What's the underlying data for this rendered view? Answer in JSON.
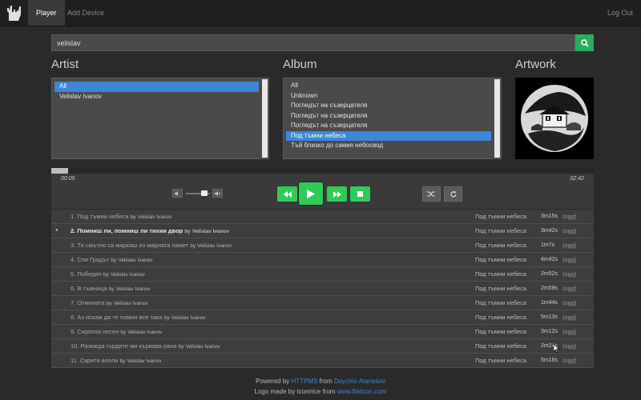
{
  "nav": {
    "tabs": [
      {
        "label": "Player"
      },
      {
        "label": "Add Device"
      }
    ],
    "logout_label": "Log Out"
  },
  "search": {
    "value": "velislav"
  },
  "sections": {
    "artist": "Artist",
    "album": "Album",
    "artwork": "Artwork"
  },
  "artists": [
    {
      "label": "All",
      "selected": true
    },
    {
      "label": "Velislav Ivanov",
      "selected": false
    }
  ],
  "albums": [
    {
      "label": "All",
      "selected": false
    },
    {
      "label": "Unknown",
      "selected": false
    },
    {
      "label": "Погледът на съзерцателя",
      "selected": false
    },
    {
      "label": "Погледът на съзерцателя",
      "selected": false
    },
    {
      "label": "Погледът на съзерцателя",
      "selected": false
    },
    {
      "label": "Под тъмни небеса",
      "selected": true
    },
    {
      "label": "Тъй близко до самия небосвод",
      "selected": false
    }
  ],
  "player": {
    "elapsed": "00:05",
    "total": "02:42",
    "progress": 0.031,
    "volume": 0.75
  },
  "tracks": [
    {
      "title": "1. Под тъмни небеса",
      "by": "by",
      "artist": "Velislav Ivanov",
      "album": "Под тъмни небеса",
      "duration": "3m15s",
      "format": "(ogg)",
      "playing": false
    },
    {
      "title": "2. Помниш ли, помниш ли тихия двор",
      "by": "by",
      "artist": "Velislav Ivanov",
      "album": "Под тъмни небеса",
      "duration": "3m42s",
      "format": "(ogg)",
      "playing": true
    },
    {
      "title": "3. Ти смътно са маркаш из марната памет",
      "by": "by",
      "artist": "Velislav Ivanov",
      "album": "Под тъмни небеса",
      "duration": "1m7s",
      "format": "(ogg)",
      "playing": false
    },
    {
      "title": "4. Спи Градът",
      "by": "by",
      "artist": "Velislav Ivanov",
      "album": "Под тъмни небеса",
      "duration": "4m42s",
      "format": "(ogg)",
      "playing": false
    },
    {
      "title": "5. Победен",
      "by": "by",
      "artist": "Velislav Ivanov",
      "album": "Под тъмни небеса",
      "duration": "2m52s",
      "format": "(ogg)",
      "playing": false
    },
    {
      "title": "6. В тъмница",
      "by": "by",
      "artist": "Velislav Ivanov",
      "album": "Под тъмни небеса",
      "duration": "2m59s",
      "format": "(ogg)",
      "playing": false
    },
    {
      "title": "7. Отмината",
      "by": "by",
      "artist": "Velislav Ivanov",
      "album": "Под тъмни небеса",
      "duration": "1m44s",
      "format": "(ogg)",
      "playing": false
    },
    {
      "title": "8. Аз искам да те помня все така",
      "by": "by",
      "artist": "Velislav Ivanov",
      "album": "Под тъмни небеса",
      "duration": "5m13s",
      "format": "(ogg)",
      "playing": false
    },
    {
      "title": "9. Сиротна песен",
      "by": "by",
      "artist": "Velislav Ivanov",
      "album": "Под тъмни небеса",
      "duration": "3m12s",
      "format": "(ogg)",
      "playing": false
    },
    {
      "title": "10. Разяжда гърдите ми кървава рана",
      "by": "by",
      "artist": "Velislav Ivanov",
      "album": "Под тъмни небеса",
      "duration": "2m24s",
      "format": "(ogg)",
      "playing": false
    },
    {
      "title": "11. Скрити вопли",
      "by": "by",
      "artist": "Velislav Ivanov",
      "album": "Под тъмни небеса",
      "duration": "5m16s",
      "format": "(ogg)",
      "playing": false
    }
  ],
  "footer": {
    "powered_prefix": "Powered by",
    "powered_project": "HTTPMS",
    "powered_from": "from",
    "powered_author": "Doychin Atanasov",
    "logo_prefix": "Logo made by Iconnice from",
    "logo_site": "www.flaticon.com"
  },
  "colors": {
    "accent_green": "#2ecc57",
    "selection_blue": "#3d86d8",
    "link_blue": "#3d86d8"
  }
}
